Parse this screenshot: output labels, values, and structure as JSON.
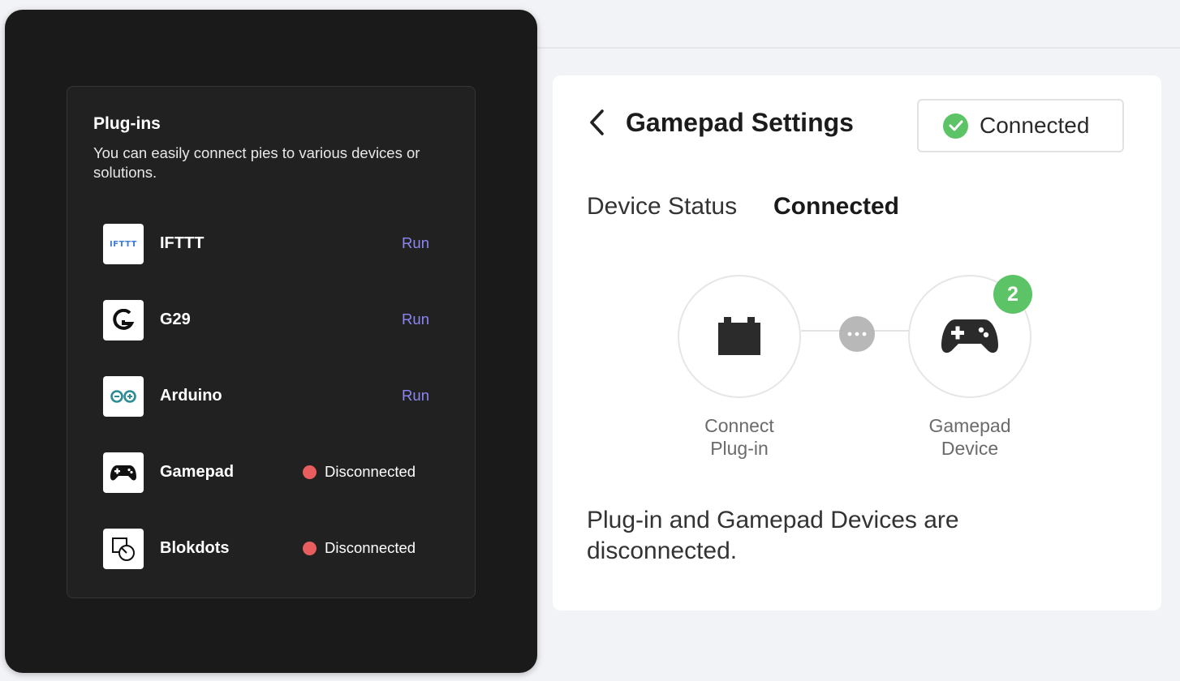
{
  "plugins": {
    "title": "Plug-ins",
    "description": "You can easily connect pies to various devices or solutions.",
    "items": [
      {
        "name": "IFTTT",
        "logo_text": "IFTTT",
        "icon": "ifttt-logo",
        "action": "Run"
      },
      {
        "name": "G29",
        "icon": "logitech-g-logo",
        "action": "Run"
      },
      {
        "name": "Arduino",
        "icon": "arduino-logo",
        "action": "Run"
      },
      {
        "name": "Gamepad",
        "icon": "gamepad-logo",
        "status": "Disconnected"
      },
      {
        "name": "Blokdots",
        "icon": "blokdots-logo",
        "status": "Disconnected"
      }
    ]
  },
  "settings": {
    "title": "Gamepad Settings",
    "badge_label": "Connected",
    "device_status_label": "Device Status",
    "device_status_value": "Connected",
    "connect_node_label": "Connect\nPlug-in",
    "device_node_label": "Gamepad\nDevice",
    "device_count": "2",
    "message": "Plug-in and Gamepad Devices are disconnected."
  },
  "colors": {
    "accent_run": "#8c86f2",
    "status_disconnected": "#e85d5d",
    "status_connected": "#5cc466"
  }
}
